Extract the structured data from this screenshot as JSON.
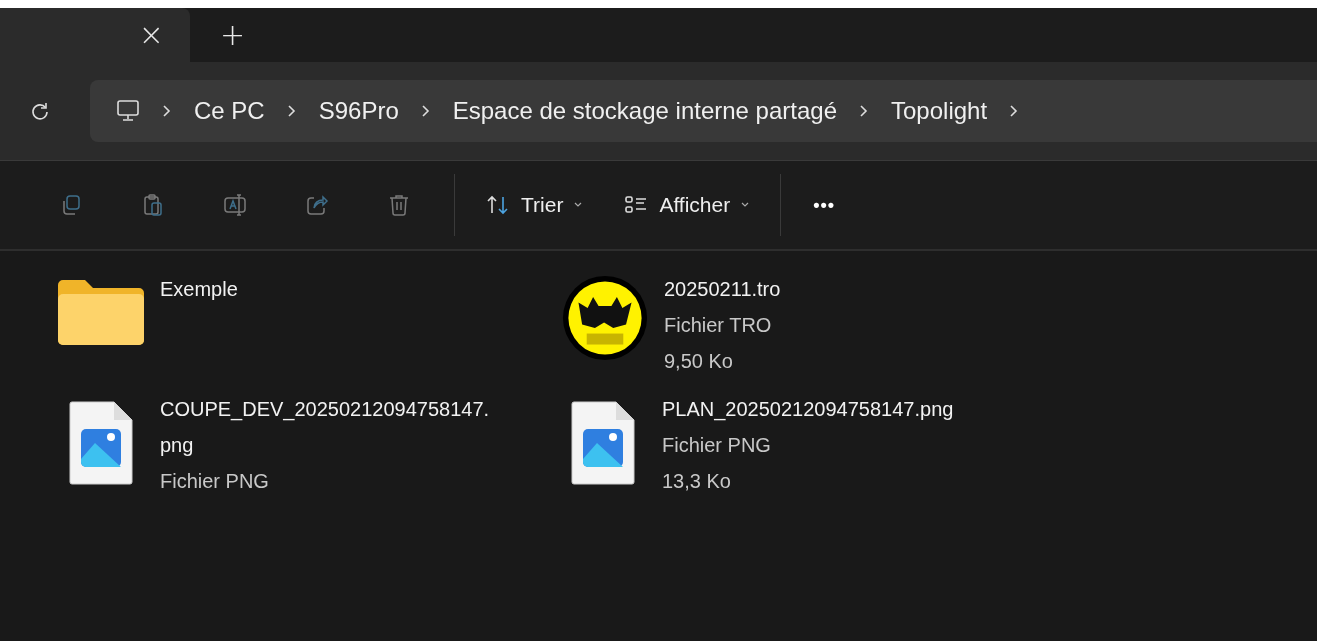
{
  "tab_bar": {
    "close": "×",
    "new_tab": "+"
  },
  "breadcrumb": [
    "Ce PC",
    "S96Pro",
    "Espace de stockage interne partagé",
    "Topolight"
  ],
  "toolbar": {
    "actions": [
      {
        "kind": "copy",
        "disabled": true
      },
      {
        "kind": "paste",
        "disabled": true
      },
      {
        "kind": "rename",
        "disabled": true
      },
      {
        "kind": "share",
        "disabled": true
      },
      {
        "kind": "delete",
        "disabled": true
      }
    ],
    "sort": "Trier",
    "view": "Afficher",
    "more": "•••"
  },
  "files": [
    {
      "kind": "folder",
      "name": "Exemple"
    },
    {
      "kind": "tro",
      "name": "20250211.tro",
      "lines": [
        "Fichier TRO",
        "9,50 Ko"
      ]
    },
    {
      "kind": "image",
      "name": "COUPE_DEV_20250212094758147.\npng",
      "lines": [
        "Fichier PNG"
      ]
    },
    {
      "kind": "image",
      "name": "PLAN_20250212094758147.png",
      "lines": [
        "Fichier PNG",
        "13,3 Ko"
      ]
    }
  ]
}
